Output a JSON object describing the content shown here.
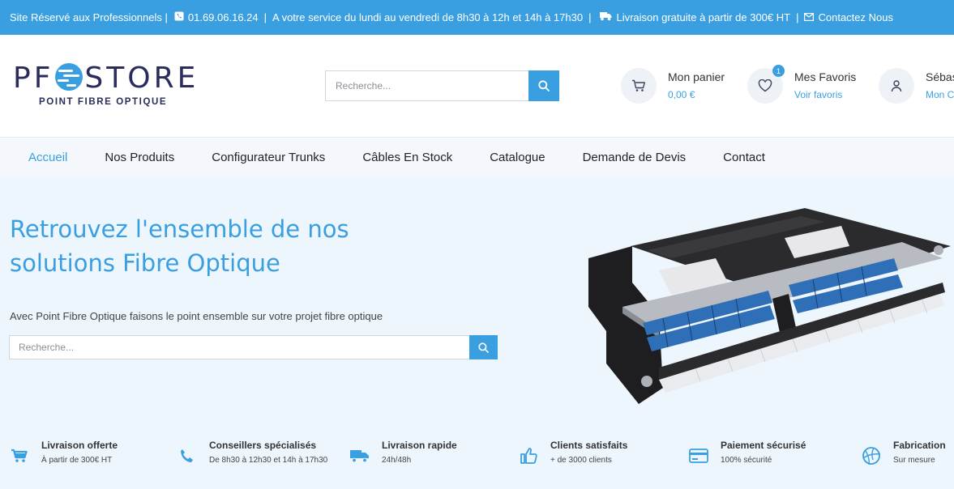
{
  "topbar": {
    "reserved": "Site Réservé aux Professionnels |",
    "phone": "01.69.06.16.24",
    "hours": "A votre service du lundi au vendredi de 8h30 à 12h et 14h à 17h30",
    "delivery": "Livraison gratuite à partir de 300€ HT",
    "contact": "Contactez Nous",
    "sep": "|"
  },
  "logo": {
    "prefix": "PF",
    "suffix": "STORE",
    "tagline": "POINT FIBRE OPTIQUE"
  },
  "header": {
    "search_placeholder": "Recherche...",
    "cart": {
      "title": "Mon panier",
      "value": "0,00 €"
    },
    "favorites": {
      "title": "Mes Favoris",
      "link": "Voir favoris",
      "count": "1"
    },
    "account": {
      "title": "Sébas",
      "link": "Mon C"
    }
  },
  "nav": {
    "items": [
      {
        "label": "Accueil",
        "active": true
      },
      {
        "label": "Nos Produits"
      },
      {
        "label": "Configurateur Trunks"
      },
      {
        "label": "Câbles En Stock"
      },
      {
        "label": "Catalogue"
      },
      {
        "label": "Demande de Devis"
      },
      {
        "label": "Contact"
      }
    ]
  },
  "hero": {
    "title": "Retrouvez l'ensemble de nos solutions Fibre Optique",
    "subtitle": "Avec Point Fibre Optique faisons le point ensemble sur votre projet fibre optique",
    "search_placeholder": "Recherche..."
  },
  "features": [
    {
      "icon": "cart-icon",
      "title": "Livraison offerte",
      "sub": "À partir de 300€ HT"
    },
    {
      "icon": "phone-icon",
      "title": "Conseillers spécialisés",
      "sub": "De 8h30 à 12h30 et 14h à 17h30"
    },
    {
      "icon": "truck-icon",
      "title": "Livraison rapide",
      "sub": "24h/48h"
    },
    {
      "icon": "thumbs-up-icon",
      "title": "Clients satisfaits",
      "sub": "+ de 3000 clients"
    },
    {
      "icon": "credit-card-icon",
      "title": "Paiement sécurisé",
      "sub": "100% sécurité"
    },
    {
      "icon": "globe-icon",
      "title": "Fabrication",
      "sub": "Sur mesure"
    }
  ],
  "colors": {
    "accent": "#3a9fe0",
    "brand_dark": "#2a2d5c",
    "hero_bg": "#eef6fd"
  }
}
